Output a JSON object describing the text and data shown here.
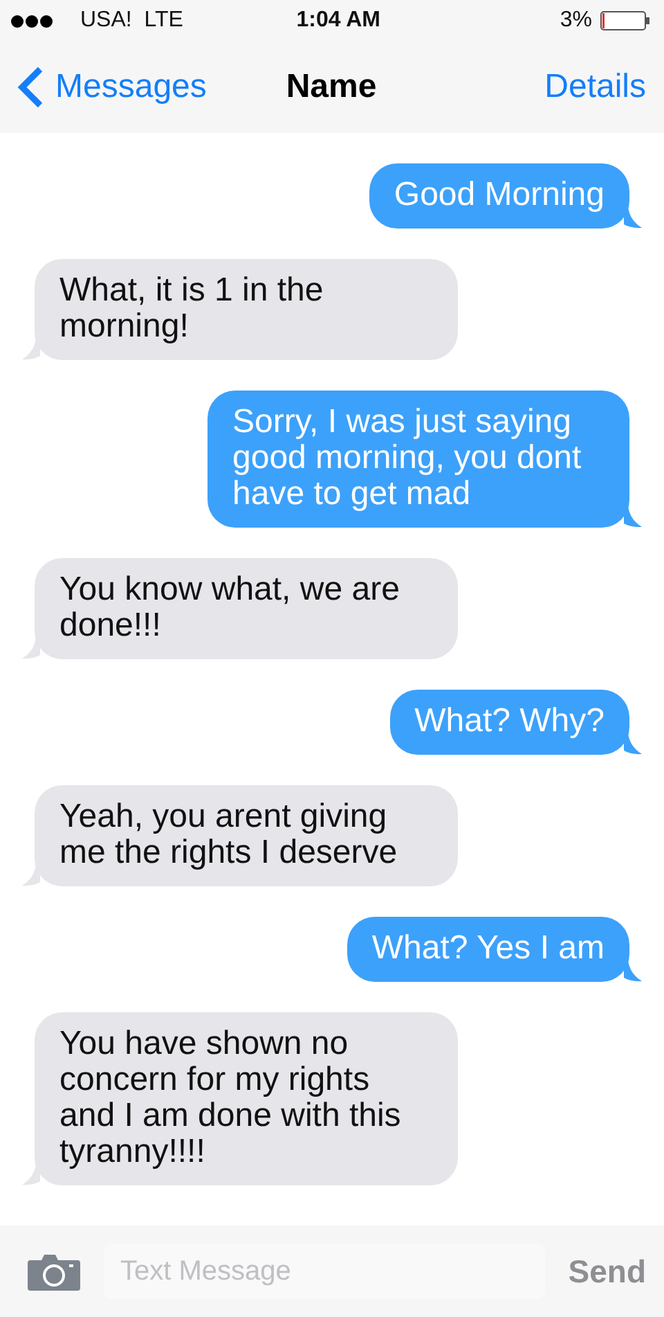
{
  "status_bar": {
    "carrier": "USA!  LTE",
    "time": "1:04 AM",
    "battery": "3%"
  },
  "nav_bar": {
    "back": "Messages",
    "title": "Name",
    "action": "Details"
  },
  "messages": [
    {
      "kind": "sent",
      "text": "Good Morning"
    },
    {
      "kind": "received",
      "text": "What, it is 1 in the morning!"
    },
    {
      "kind": "sent",
      "text": "Sorry, I was just saying good morning, you dont have to get mad"
    },
    {
      "kind": "received",
      "text": "You know what, we are done!!!"
    },
    {
      "kind": "sent",
      "text": "What? Why?"
    },
    {
      "kind": "received",
      "text": "Yeah, you arent giving me the rights I deserve"
    },
    {
      "kind": "sent",
      "text": "What? Yes I am"
    },
    {
      "kind": "received",
      "text": "You have shown no concern for my rights and I am done with this tyranny!!!!"
    }
  ],
  "input_bar": {
    "placeholder": "Text Message",
    "send": "Send"
  }
}
